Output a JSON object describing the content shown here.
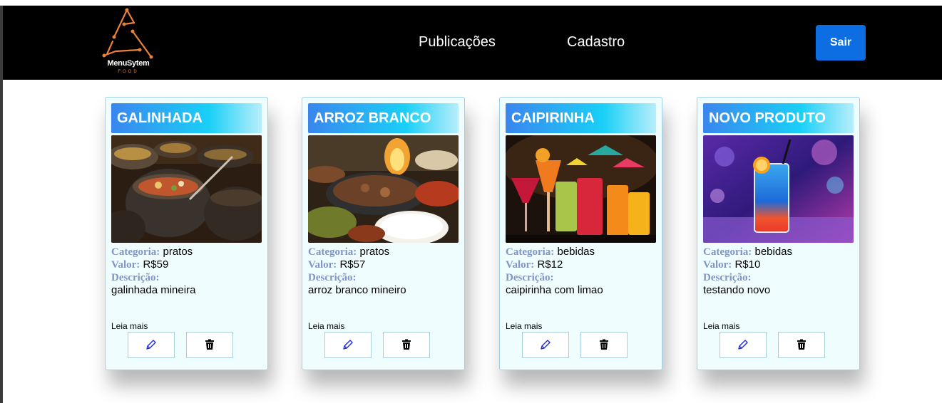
{
  "navbar": {
    "logo_text": "MenuSytem",
    "logo_sub": "FOOD",
    "links": [
      {
        "label": "Publicações"
      },
      {
        "label": "Cadastro"
      }
    ],
    "logout_label": "Sair"
  },
  "labels": {
    "categoria": "Categoria:",
    "valor": "Valor:",
    "descricao": "Descrição:",
    "leia_mais": "Leia mais"
  },
  "products": [
    {
      "title": "GALINHADA",
      "categoria": "pratos",
      "valor": "R$59",
      "descricao": "galinhada mineira"
    },
    {
      "title": "ARROZ BRANCO",
      "categoria": "pratos",
      "valor": "R$57",
      "descricao": "arroz branco mineiro"
    },
    {
      "title": "CAIPIRINHA",
      "categoria": "bebidas",
      "valor": "R$12",
      "descricao": "caipirinha com limao"
    },
    {
      "title": "NOVO PRODUTO",
      "categoria": "bebidas",
      "valor": "R$10",
      "descricao": "testando novo"
    }
  ],
  "icons": {
    "edit": "pencil-icon",
    "delete": "trash-icon"
  },
  "colors": {
    "navbar_bg": "#000000",
    "logout_btn": "#0d6de3",
    "card_bg": "#f0fdff",
    "label_color": "#7f95c8",
    "logo_accent": "#e8823a"
  }
}
